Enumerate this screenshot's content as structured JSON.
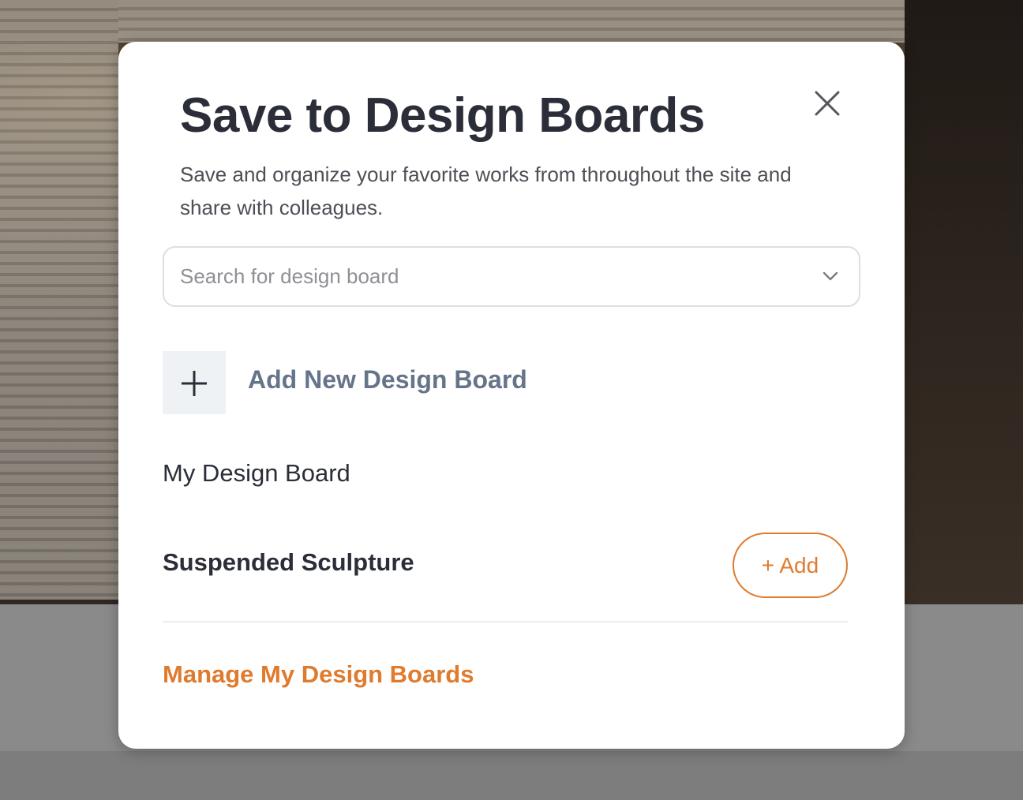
{
  "modal": {
    "title": "Save to Design Boards",
    "description": "Save and organize your favorite works from throughout the site and share with colleagues.",
    "close_icon": "close-icon"
  },
  "search": {
    "placeholder": "Search for design board",
    "value": "",
    "dropdown_icon": "chevron-down-icon"
  },
  "add_new": {
    "label": "Add New Design Board",
    "icon": "plus-icon"
  },
  "board": {
    "name": "My Design Board",
    "item_title": "Suspended Sculpture",
    "add_label": "+ Add"
  },
  "footer": {
    "manage_label": "Manage My Design Boards"
  },
  "colors": {
    "accent": "#e07b2e",
    "title_text": "#2b2d38",
    "add_new_text": "#66748a",
    "plus_box_bg": "#eef2f4",
    "overlay": "#7b7b7b"
  }
}
